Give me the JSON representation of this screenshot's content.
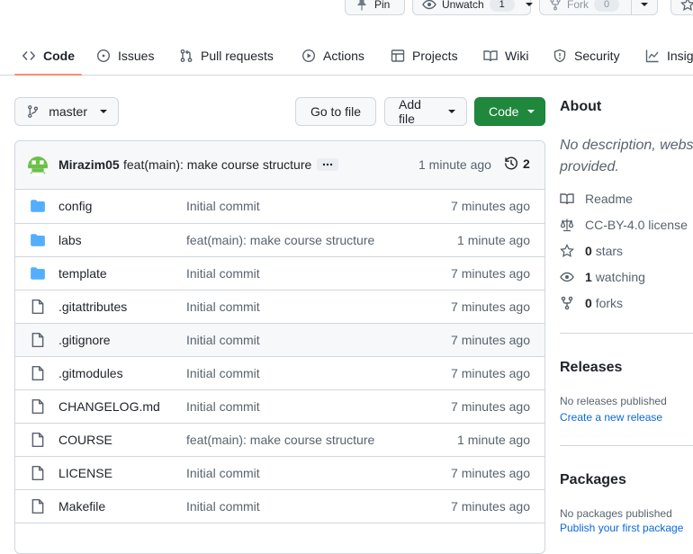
{
  "header_actions": {
    "pin_label": "Pin",
    "unwatch_label": "Unwatch",
    "watch_count": "1",
    "fork_label": "Fork",
    "fork_count": "0"
  },
  "nav": {
    "tabs": [
      {
        "label": "Code",
        "icon": "code-icon",
        "active": true
      },
      {
        "label": "Issues",
        "icon": "issue-icon"
      },
      {
        "label": "Pull requests",
        "icon": "pull-request-icon"
      },
      {
        "label": "Actions",
        "icon": "play-icon"
      },
      {
        "label": "Projects",
        "icon": "table-icon"
      },
      {
        "label": "Wiki",
        "icon": "book-icon"
      },
      {
        "label": "Security",
        "icon": "shield-icon"
      },
      {
        "label": "Insig",
        "icon": "graph-icon"
      }
    ]
  },
  "toolbar": {
    "branch": "master",
    "go_to_file": "Go to file",
    "add_file": "Add file",
    "code": "Code"
  },
  "latest_commit": {
    "author": "Mirazim05",
    "message": "feat(main): make course structure",
    "age": "1 minute ago",
    "commit_count": "2"
  },
  "files": [
    {
      "name": "config",
      "type": "dir",
      "message": "Initial commit",
      "age": "7 minutes ago"
    },
    {
      "name": "labs",
      "type": "dir",
      "message": "feat(main): make course structure",
      "age": "1 minute ago"
    },
    {
      "name": "template",
      "type": "dir",
      "message": "Initial commit",
      "age": "7 minutes ago"
    },
    {
      "name": ".gitattributes",
      "type": "file",
      "message": "Initial commit",
      "age": "7 minutes ago"
    },
    {
      "name": ".gitignore",
      "type": "file",
      "message": "Initial commit",
      "age": "7 minutes ago"
    },
    {
      "name": ".gitmodules",
      "type": "file",
      "message": "Initial commit",
      "age": "7 minutes ago"
    },
    {
      "name": "CHANGELOG.md",
      "type": "file",
      "message": "Initial commit",
      "age": "7 minutes ago"
    },
    {
      "name": "COURSE",
      "type": "file",
      "message": "feat(main): make course structure",
      "age": "1 minute ago"
    },
    {
      "name": "LICENSE",
      "type": "file",
      "message": "Initial commit",
      "age": "7 minutes ago"
    },
    {
      "name": "Makefile",
      "type": "file",
      "message": "Initial commit",
      "age": "7 minutes ago"
    },
    {
      "name": "",
      "type": "file",
      "message": "",
      "age": ""
    }
  ],
  "about": {
    "title": "About",
    "description_line1": "No description, webs",
    "description_line2": "provided.",
    "readme": "Readme",
    "license": "CC-BY-4.0 license",
    "stars_count": "0",
    "stars_label": "stars",
    "watching_count": "1",
    "watching_label": "watching",
    "forks_count": "0",
    "forks_label": "forks"
  },
  "releases": {
    "title": "Releases",
    "none_text": "No releases published",
    "create_link": "Create a new release"
  },
  "packages": {
    "title": "Packages",
    "none_text": "No packages published",
    "publish_link": "Publish your first package"
  },
  "colors": {
    "accent_green": "#1f883d",
    "link_blue": "#0969da",
    "folder_blue": "#54aeff",
    "tab_underline": "#fd8c73"
  }
}
